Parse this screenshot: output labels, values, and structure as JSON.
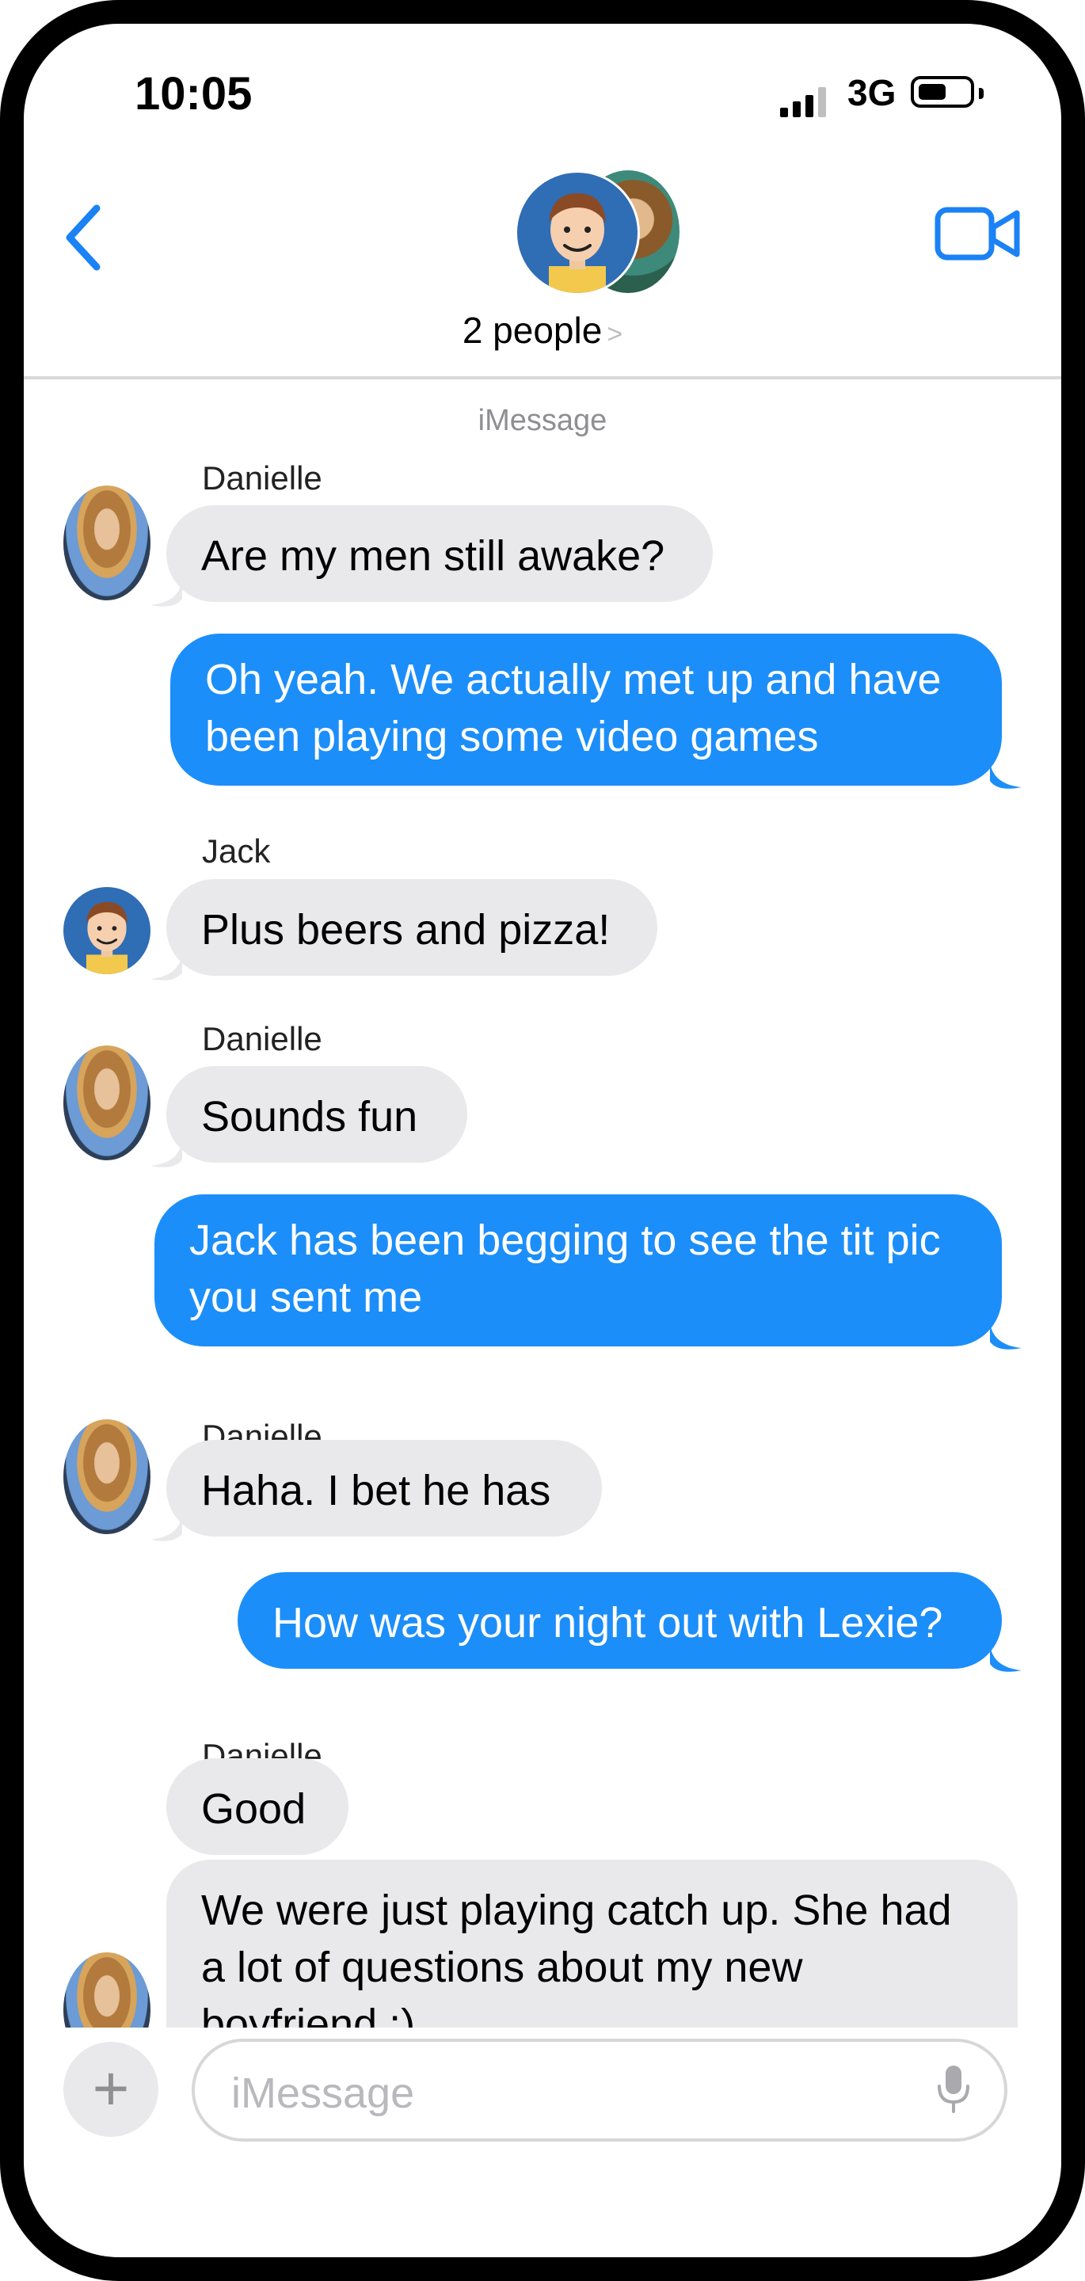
{
  "status_bar": {
    "time": "10:05",
    "network": "3G"
  },
  "header": {
    "group_label": "2 people",
    "chevron": ">"
  },
  "service_label": "iMessage",
  "messages": [
    {
      "sender": "Danielle",
      "text": "Are my men still awake?",
      "direction": "incoming"
    },
    {
      "lines": [
        "Oh yeah.  We actually met up and have",
        "been playing some video games"
      ],
      "direction": "outgoing"
    },
    {
      "sender": "Jack",
      "text": "Plus beers and pizza!",
      "direction": "incoming"
    },
    {
      "sender": "Danielle",
      "text": "Sounds fun",
      "direction": "incoming"
    },
    {
      "lines": [
        "Jack has been begging to see the tit pic",
        "you sent me"
      ],
      "direction": "outgoing"
    },
    {
      "sender": "Danielle",
      "text": "Haha.  I bet he has",
      "direction": "incoming"
    },
    {
      "text": "How was your night out with Lexie?",
      "direction": "outgoing"
    },
    {
      "sender": "Danielle",
      "text": "Good",
      "direction": "incoming"
    },
    {
      "lines": [
        "We were just playing catch up.  She had",
        "a lot of questions about my new",
        "boyfriend :)"
      ],
      "direction": "incoming"
    }
  ],
  "composer": {
    "placeholder": "iMessage",
    "plus": "+"
  },
  "colors": {
    "accent": "#1c8ef9",
    "incoming_bubble": "#e9e9eb",
    "back_chevron": "#1a82f5"
  }
}
